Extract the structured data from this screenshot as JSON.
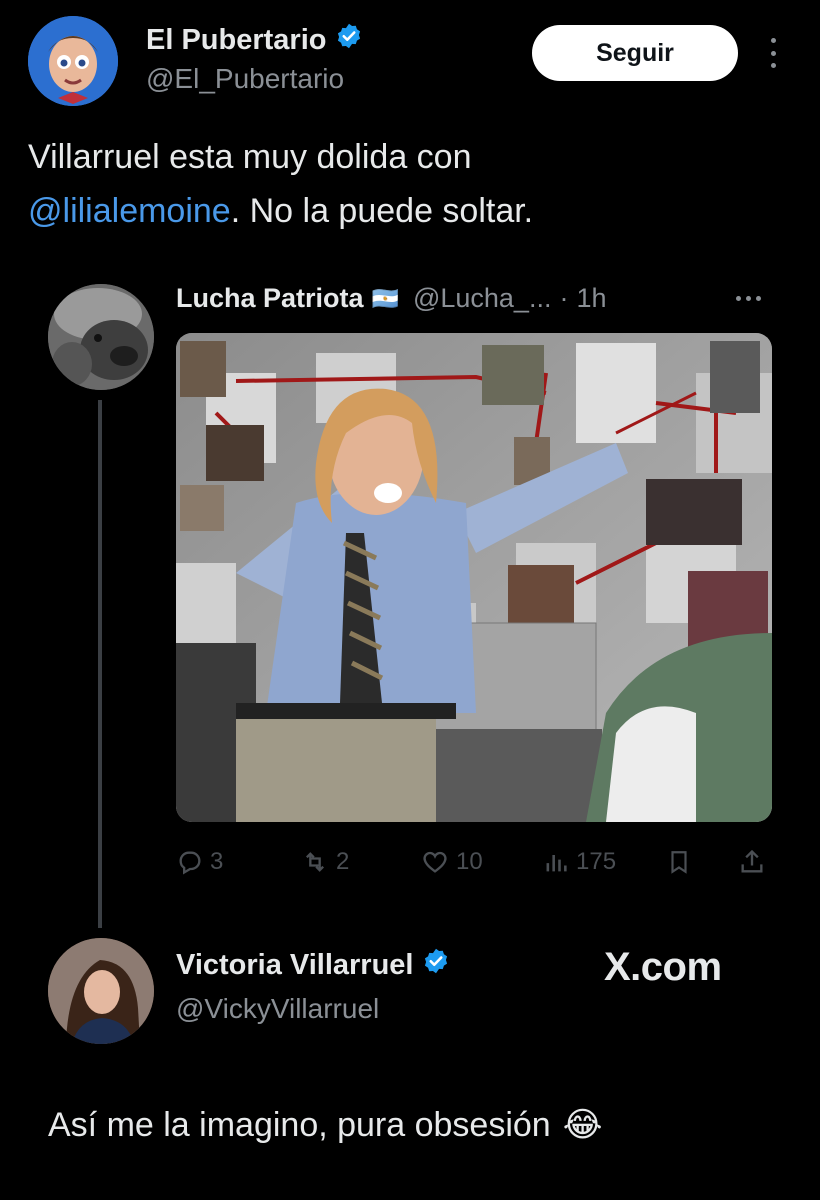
{
  "author": {
    "name": "El Pubertario",
    "handle": "@El_Pubertario",
    "verified": true
  },
  "follow_label": "Seguir",
  "tweet": {
    "text_before": "Villarruel esta muy dolida con ",
    "mention": "@lilialemoine",
    "text_after": ". No la puede soltar."
  },
  "quoted": {
    "name": "Lucha Patriota",
    "flag": "🇦🇷",
    "handle": "@Lucha_...",
    "sep": "·",
    "time": "1h",
    "stats": {
      "replies": "3",
      "retweets": "2",
      "likes": "10",
      "views": "175"
    }
  },
  "reply": {
    "name": "Victoria Villarruel",
    "handle": "@VickyVillarruel",
    "verified": true,
    "watermark": "X.com",
    "text": "Así me la imagino, pura obsesión",
    "emoji": "😂"
  },
  "colors": {
    "background": "#000000",
    "text": "#e7e9ea",
    "muted": "#8b9096",
    "link": "#4a99e9",
    "verified": "#1d9bf0",
    "action_icons": "#4b4f54"
  },
  "icons": [
    "verified-badge-icon",
    "more-icon",
    "reply-icon",
    "retweet-icon",
    "like-icon",
    "views-icon",
    "bookmark-icon",
    "share-icon"
  ]
}
